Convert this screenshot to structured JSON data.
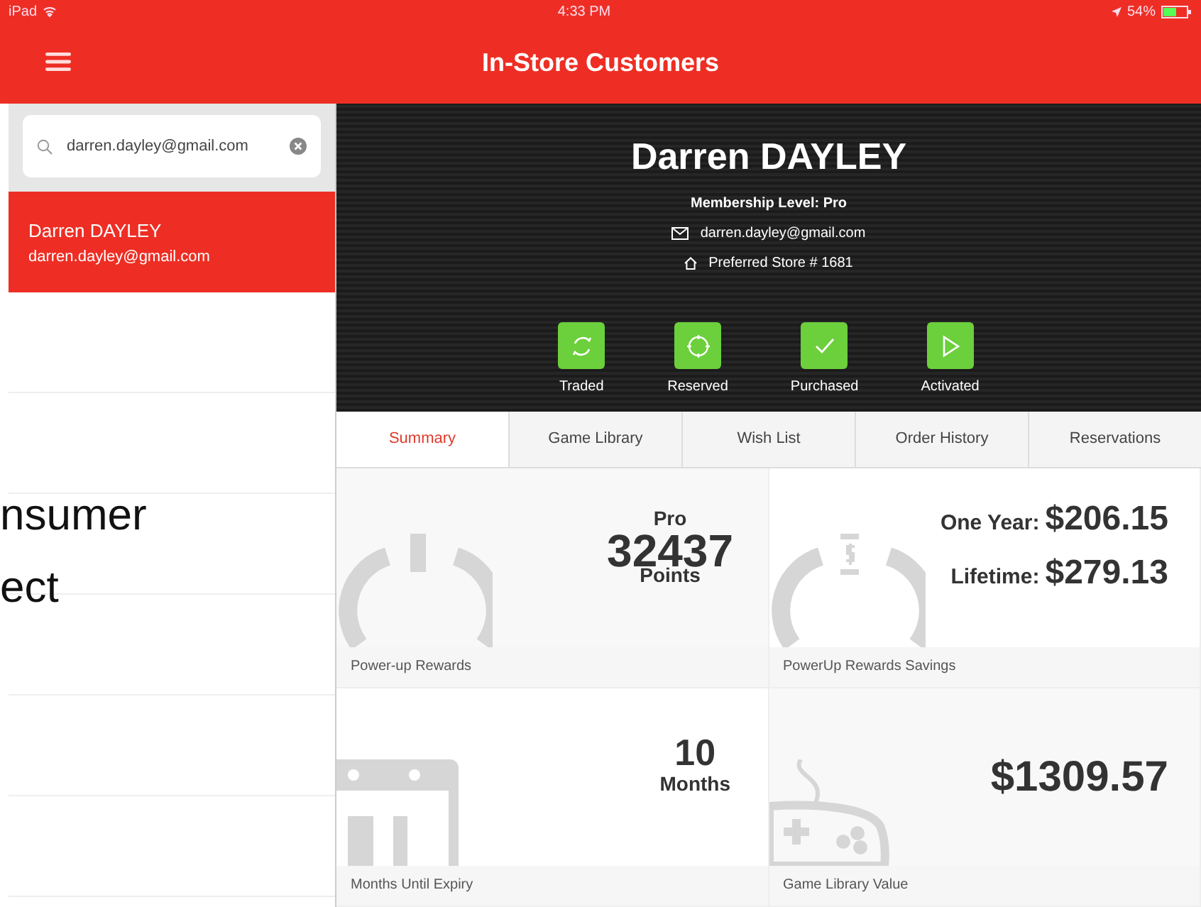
{
  "status_bar": {
    "device": "iPad",
    "time": "4:33 PM",
    "battery": "54%"
  },
  "header": {
    "title": "In-Store Customers"
  },
  "search": {
    "value": "darren.dayley@gmail.com"
  },
  "customers": [
    {
      "name": "Darren DAYLEY",
      "email": "darren.dayley@gmail.com",
      "selected": true
    }
  ],
  "overlay_text": [
    "nsumer",
    "ect"
  ],
  "profile": {
    "name": "Darren DAYLEY",
    "membership_label": "Membership Level:",
    "membership_value": "Pro",
    "email": "darren.dayley@gmail.com",
    "store": "Preferred Store # 1681"
  },
  "actions": [
    {
      "kind": "traded",
      "label": "Traded"
    },
    {
      "kind": "reserved",
      "label": "Reserved"
    },
    {
      "kind": "purchased",
      "label": "Purchased"
    },
    {
      "kind": "activated",
      "label": "Activated"
    }
  ],
  "tabs": [
    {
      "label": "Summary",
      "selected": true
    },
    {
      "label": "Game Library",
      "selected": false
    },
    {
      "label": "Wish List",
      "selected": false
    },
    {
      "label": "Order History",
      "selected": false
    },
    {
      "label": "Reservations",
      "selected": false
    }
  ],
  "tiles": [
    {
      "kind": "rewards",
      "lines": [
        "Pro",
        "32437",
        "Points"
      ],
      "caption": "Power-up Rewards"
    },
    {
      "kind": "savings",
      "lines": [
        [
          "One Year:",
          "$206.15"
        ],
        [
          "Lifetime:",
          "$279.13"
        ]
      ],
      "caption": "PowerUp Rewards Savings"
    },
    {
      "kind": "expiry",
      "lines": [
        "10",
        "Months"
      ],
      "caption": "Months Until Expiry"
    },
    {
      "kind": "library",
      "lines": [
        "$1309.57"
      ],
      "caption": "Game Library Value"
    }
  ]
}
